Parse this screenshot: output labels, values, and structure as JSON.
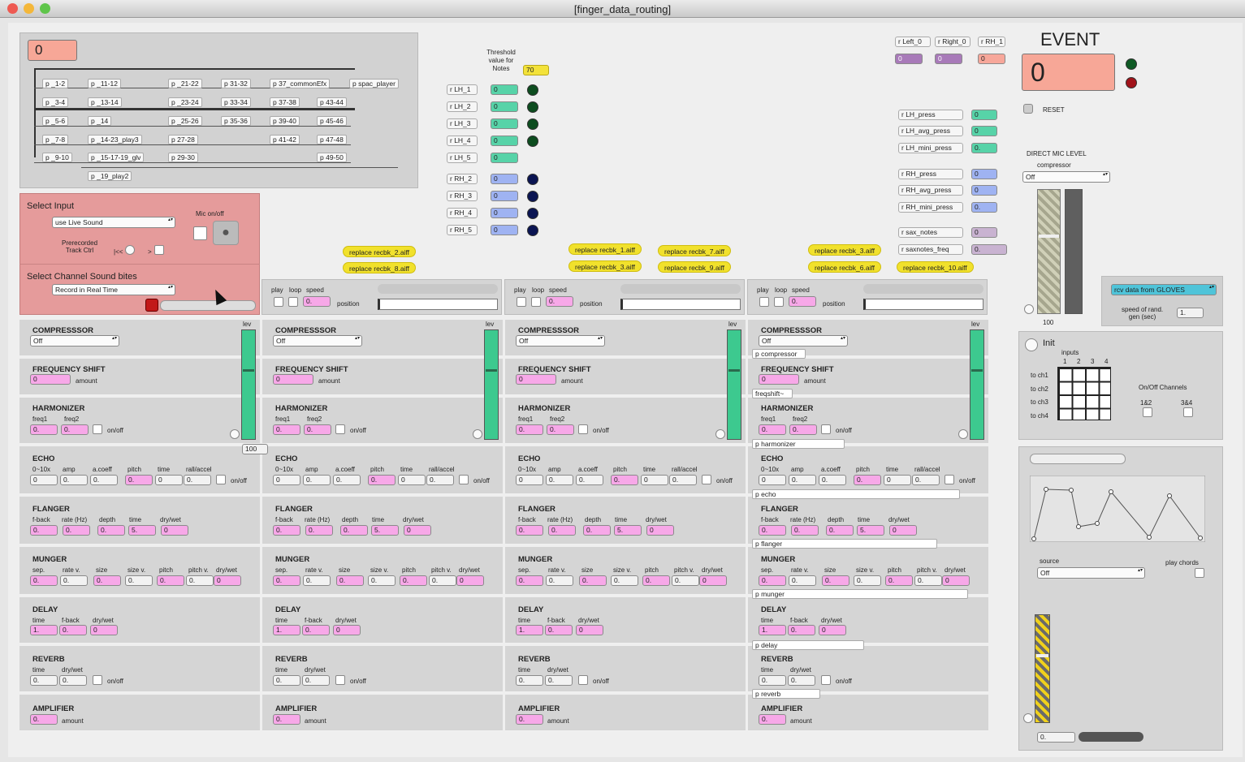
{
  "window": {
    "title": "[finger_data_routing]"
  },
  "top": {
    "main_num": "0",
    "patches": [
      "p _1-2",
      "p _11-12",
      "p _21-22",
      "p 31-32",
      "p 37_commonEfx",
      "p spac_player",
      "p _3-4",
      "p _13-14",
      "p _23-24",
      "p 33-34",
      "p 37-38",
      "p 43-44",
      "p _5-6",
      "p _14",
      "p _25-26",
      "p 35-36",
      "p 39-40",
      "p 45-46",
      "p _7-8",
      "p _14-23_play3",
      "p 27-28",
      "p 41-42",
      "p 47-48",
      "p _9-10",
      "p _15-17-19_glv",
      "p 29-30",
      "p 49-50",
      "p _19_play2"
    ]
  },
  "input": {
    "title": "Select Input",
    "value": "use Live Sound",
    "mic_label": "Mic on/off",
    "prerec": "Prerecorded\nTrack Ctrl",
    "rew": "|<<",
    "play": ">",
    "channel_title": "Select Channel Sound bites",
    "channel_value": "Record in Real Time"
  },
  "threshold": {
    "label": "Threshold value for Notes",
    "value": "70"
  },
  "receivers_l": [
    {
      "name": "r LH_1",
      "v": "0"
    },
    {
      "name": "r LH_2",
      "v": "0"
    },
    {
      "name": "r LH_3",
      "v": "0"
    },
    {
      "name": "r LH_4",
      "v": "0"
    },
    {
      "name": "r LH_5",
      "v": "0"
    },
    {
      "name": "r RH_2",
      "v": "0"
    },
    {
      "name": "r RH_3",
      "v": "0"
    },
    {
      "name": "r RH_4",
      "v": "0"
    },
    {
      "name": "r RH_5",
      "v": "0"
    }
  ],
  "receivers_r": [
    {
      "name": "r LH_press",
      "v": "0"
    },
    {
      "name": "r LH_avg_press",
      "v": "0"
    },
    {
      "name": "r LH_mini_press",
      "v": "0."
    },
    {
      "name": "r RH_press",
      "v": "0"
    },
    {
      "name": "r RH_avg_press",
      "v": "0"
    },
    {
      "name": "r RH_mini_press",
      "v": "0."
    },
    {
      "name": "r sax_notes",
      "v": "0"
    },
    {
      "name": "r saxnotes_freq",
      "v": "0."
    }
  ],
  "lr": [
    {
      "name": "r Left_0",
      "v": "0"
    },
    {
      "name": "r Right_0",
      "v": "0"
    },
    {
      "name": "r RH_1",
      "v": "0"
    }
  ],
  "replace": [
    "replace recbk_2.aiff",
    "replace recbk_8.aiff",
    "replace recbk_1.aiff",
    "replace recbk_3.aiff",
    "replace recbk_7.aiff",
    "replace recbk_9.aiff",
    "replace recbk_3.aiff",
    "replace recbk_6.aiff",
    "replace recbk_10.aiff"
  ],
  "player": {
    "play": "play",
    "loop": "loop",
    "speed": "speed",
    "speed_val": "0.",
    "position": "position"
  },
  "channel": {
    "lev": "lev",
    "lev_val": "100",
    "comp": "COMPRESSSOR",
    "comp_val": "Off",
    "fs": "FREQUENCY SHIFT",
    "fs_val": "0",
    "amount": "amount",
    "harm": "HARMONIZER",
    "freq1": "freq1",
    "freq2": "freq2",
    "zero": "0.",
    "onoff": "on/off",
    "echo": "ECHO",
    "echo_labels": [
      "0~10x",
      "amp",
      "a.coeff",
      "pitch",
      "time",
      "rall/accel"
    ],
    "echo_vals": [
      "0",
      "0.",
      "0.",
      "0.",
      "0",
      "0."
    ],
    "flanger": "FLANGER",
    "flanger_labels": [
      "f-back",
      "rate (Hz)",
      "depth",
      "time",
      "dry/wet"
    ],
    "flanger_vals": [
      "0.",
      "0.",
      "0.",
      "5.",
      "0"
    ],
    "munger": "MUNGER",
    "munger_labels": [
      "sep.",
      "rate v.",
      "size",
      "size v.",
      "pitch",
      "pitch v.",
      "dry/wet"
    ],
    "munger_vals": [
      "0.",
      "0.",
      "0.",
      "0.",
      "0.",
      "0.",
      "0"
    ],
    "delay": "DELAY",
    "delay_labels": [
      "time",
      "f-back",
      "dry/wet"
    ],
    "delay_vals": [
      "1.",
      "0.",
      "0"
    ],
    "reverb": "REVERB",
    "reverb_labels": [
      "time",
      "dry/wet"
    ],
    "reverb_vals": [
      "0.",
      "0."
    ],
    "amp": "AMPLIFIER",
    "amp_val": "0."
  },
  "ch4_patches": [
    "p compressor",
    "freqshift~",
    "p harmonizer",
    "p echo",
    "p flanger",
    "p munger",
    "p delay",
    "p reverb"
  ],
  "event": {
    "title": "EVENT",
    "value": "0",
    "reset": "RESET"
  },
  "mic": {
    "title": "DIRECT MIC LEVEL",
    "comp": "compressor",
    "comp_val": "Off",
    "level": "100",
    "rcv": "rcv data from GLOVES",
    "speed_label": "speed of rand.\ngen (sec)",
    "speed_val": "1."
  },
  "matrix": {
    "init": "Init",
    "inputs": "inputs",
    "cols": [
      "1",
      "2",
      "3",
      "4"
    ],
    "rows": [
      "to ch1",
      "to ch2",
      "to ch3",
      "to ch4"
    ],
    "onoff": "On/Off Channels",
    "c12": "1&2",
    "c34": "3&4"
  },
  "graph": {
    "source": "source",
    "source_val": "Off",
    "chords": "play chords",
    "bottom_val": "0."
  }
}
